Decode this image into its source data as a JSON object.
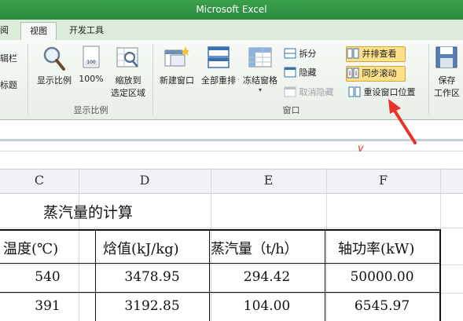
{
  "window": {
    "title": "Microsoft Excel"
  },
  "tabs": {
    "prev_partial": "阅",
    "view": "视图",
    "developer": "开发工具"
  },
  "ribbon": {
    "left_partial": {
      "line1": "辑栏",
      "line2": "标题"
    },
    "zoom_group": {
      "label": "显示比例",
      "zoom": "显示比例",
      "hundred": "100%",
      "hundred_icon_text": "100",
      "zoom_to_selection": {
        "line1": "缩放到",
        "line2": "选定区域"
      }
    },
    "window_group": {
      "label": "窗口",
      "new_window": "新建窗口",
      "arrange_all": "全部重排",
      "freeze_panes": "冻结窗格",
      "split": "拆分",
      "hide": "隐藏",
      "unhide": "取消隐藏",
      "view_side_by_side": "并排查看",
      "sync_scroll": "同步滚动",
      "reset_position": "重设窗口位置",
      "save_workspace": {
        "line1": "保存",
        "line2": "工作区"
      }
    }
  },
  "sheet": {
    "columns": [
      "C",
      "D",
      "E",
      "F"
    ],
    "title": "蒸汽量的计算",
    "headers": [
      "温度(℃)",
      "焓值(kJ/kg)",
      "蒸汽量（t/h）",
      "轴功率(kW)"
    ],
    "rows": [
      [
        "540",
        "3478.95",
        "294.42",
        "50000.00"
      ],
      [
        "391",
        "3192.85",
        "104.00",
        "6545.97"
      ]
    ],
    "formula_mark": "v"
  },
  "colors": {
    "title_bar": "#2b8a3e",
    "annotation": "#e8322a",
    "highlight": "#fde18a"
  }
}
